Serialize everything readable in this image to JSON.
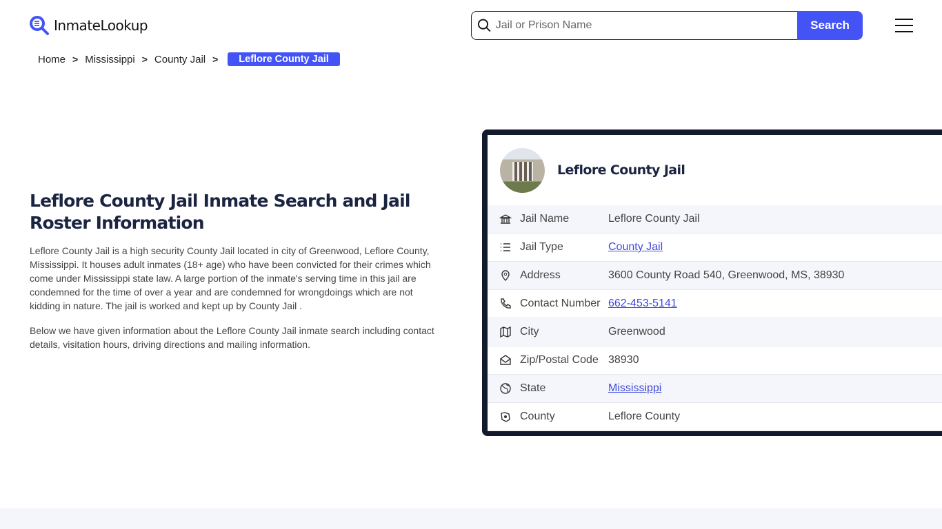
{
  "header": {
    "logo": "InmateLookup",
    "search_placeholder": "Jail or Prison Name",
    "search_button": "Search"
  },
  "breadcrumb": [
    "Home",
    "Mississippi",
    "County Jail",
    "Leflore County Jail"
  ],
  "main": {
    "title": "Leflore County Jail Inmate Search and Jail Roster Information",
    "paragraphs": [
      "Leflore County Jail is a high security County Jail located in city of Greenwood, Leflore County, Mississippi. It houses adult inmates (18+ age) who have been convicted for their crimes which come under Mississippi state law. A large portion of the inmate's serving time in this jail are condemned for the time of over a year and are condemned for wrongdoings which are not kidding in nature. The jail is worked and kept up by County Jail .",
      "Below we have given information about the Leflore County Jail inmate search including contact details, visitation hours, driving directions and mailing information."
    ]
  },
  "card": {
    "title": "Leflore County Jail",
    "rows": [
      {
        "icon": "bank-icon",
        "label": "Jail Name",
        "value": "Leflore County Jail",
        "link": false
      },
      {
        "icon": "list-icon",
        "label": "Jail Type",
        "value": "County Jail",
        "link": true
      },
      {
        "icon": "map-pin-icon",
        "label": "Address",
        "value": "3600 County Road 540, Greenwood, MS, 38930",
        "link": false
      },
      {
        "icon": "phone-icon",
        "label": "Contact Number",
        "value": "662-453-5141",
        "link": true
      },
      {
        "icon": "map-icon",
        "label": "City",
        "value": "Greenwood",
        "link": false
      },
      {
        "icon": "mail-icon",
        "label": "Zip/Postal Code",
        "value": "38930",
        "link": false
      },
      {
        "icon": "globe-icon",
        "label": "State",
        "value": "Mississippi",
        "link": true
      },
      {
        "icon": "county-icon",
        "label": "County",
        "value": "Leflore County",
        "link": false
      }
    ]
  },
  "colors": {
    "accent": "#4353f5",
    "card_border": "#141a2e"
  }
}
